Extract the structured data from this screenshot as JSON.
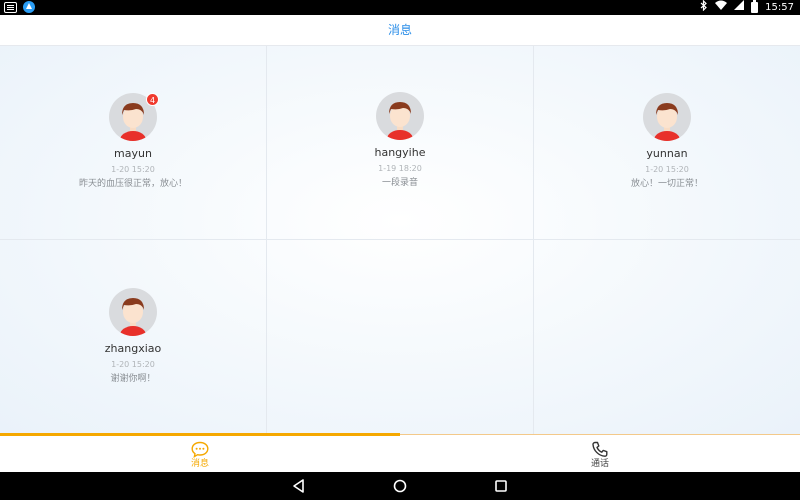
{
  "status_bar": {
    "time": "15:57",
    "icons": [
      "notification-icon",
      "app-icon",
      "bluetooth-icon",
      "wifi-icon",
      "signal-icon",
      "battery-icon"
    ]
  },
  "header": {
    "title": "消息"
  },
  "contacts": [
    {
      "name": "mayun",
      "time": "1-20 15:20",
      "message": "昨天的血压很正常，放心！",
      "badge": "4"
    },
    {
      "name": "hangyihe",
      "time": "1-19 18:20",
      "message": "一段录音",
      "badge": ""
    },
    {
      "name": "yunnan",
      "time": "1-20 15:20",
      "message": "放心！一切正常！",
      "badge": ""
    },
    {
      "name": "zhangxiao",
      "time": "1-20 15:20",
      "message": "谢谢你啊！",
      "badge": ""
    }
  ],
  "tabs": [
    {
      "label": "消息",
      "icon": "chat-bubble-icon",
      "active": true
    },
    {
      "label": "通话",
      "icon": "phone-icon",
      "active": false
    }
  ],
  "nav": {
    "icons": [
      "back-icon",
      "home-icon",
      "recents-icon"
    ]
  },
  "colors": {
    "accent": "#f5a800",
    "title_blue": "#2b8ee8",
    "badge_red": "#f03a2e",
    "avatar_shirt": "#e8302a",
    "avatar_hair": "#8a3b1e"
  }
}
